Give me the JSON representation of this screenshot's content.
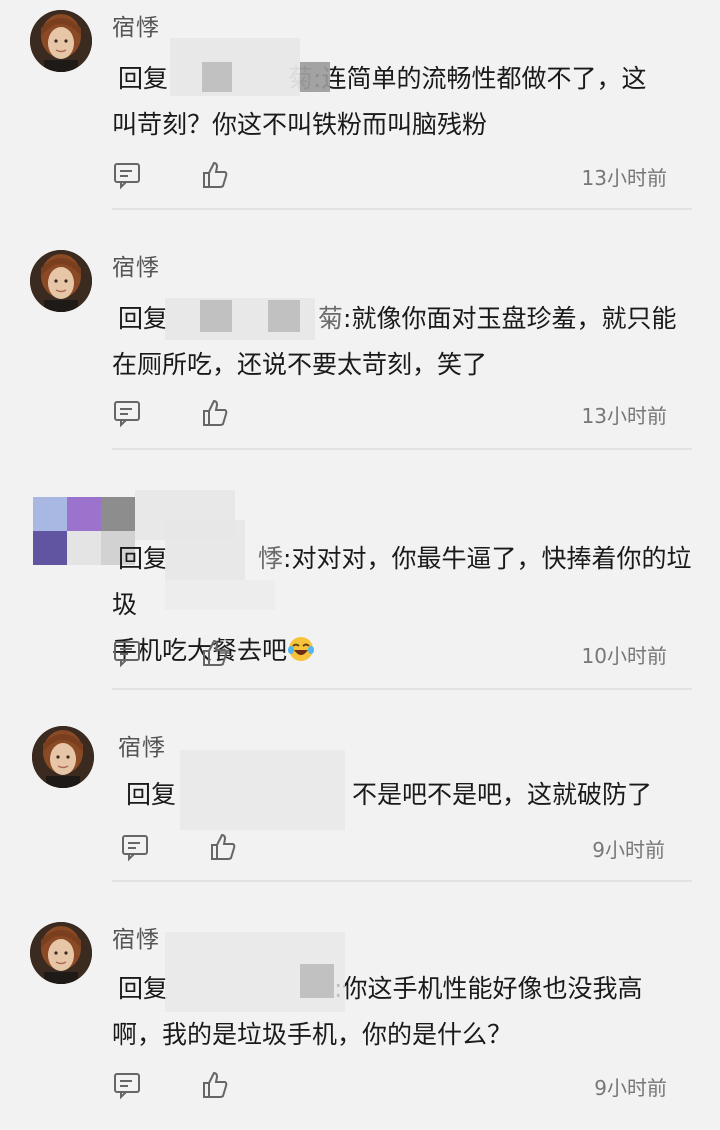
{
  "comments": [
    {
      "username": "宿悸",
      "reply_prefix": "回复",
      "target_tail": "菊",
      "lines": [
        ":连简单的流畅性都做不了，这",
        "叫苛刻？你这不叫铁粉而叫脑残粉"
      ],
      "time": "13小时前"
    },
    {
      "username": "宿悸",
      "reply_prefix": "回复",
      "target_tail": "菊",
      "lines": [
        ":就像你面对玉盘珍羞，就只能",
        "在厕所吃，还说不要太苛刻，笑了"
      ],
      "time": "13小时前"
    },
    {
      "username": "",
      "reply_prefix": "回复",
      "target_tail": "悸",
      "lines": [
        ":对对对，你最牛逼了，快捧着你的垃圾",
        "手机吃大餐去吧"
      ],
      "emoji": "laughing-tears-emoji",
      "time": "10小时前"
    },
    {
      "username": "宿悸",
      "reply_prefix": "回复",
      "target_tail": "",
      "lines": [
        "不是吧不是吧，这就破防了"
      ],
      "time": "9小时前"
    },
    {
      "username": "宿悸",
      "reply_prefix": "回复",
      "target_tail": "",
      "lines": [
        ":你这手机性能好像也没我高",
        "啊，我的是垃圾手机，你的是什么？"
      ],
      "time": "9小时前"
    }
  ],
  "icons": {
    "reply": "comment-bubble-icon",
    "like": "thumbs-up-icon"
  },
  "colors": {
    "background": "#f2f2f2",
    "text": "#1a1a1a",
    "muted": "#777777",
    "divider": "#e2e2e2"
  }
}
